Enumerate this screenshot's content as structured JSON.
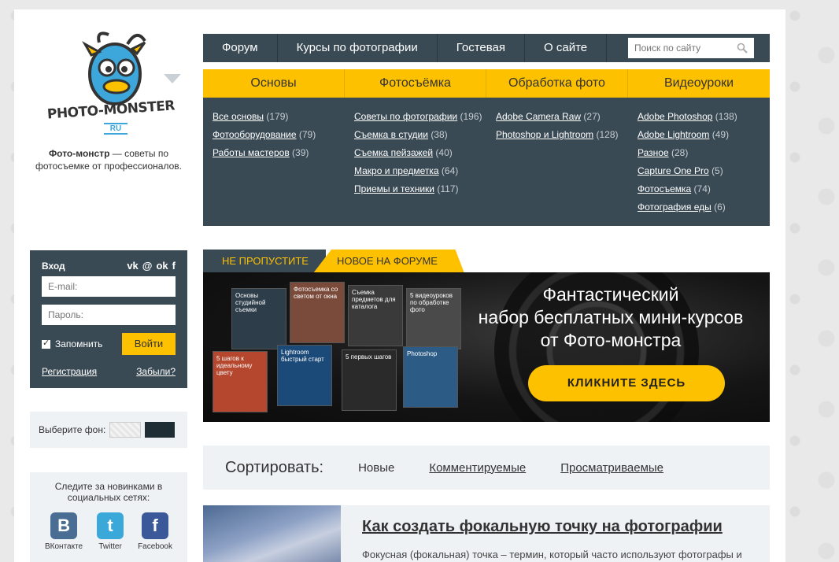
{
  "logo": {
    "brand": "PHOTO-MONSTER",
    "tld": "RU"
  },
  "tagline": {
    "bold": "Фото-монстр",
    "rest": " — советы по фотосъемке от профессионалов."
  },
  "topnav": {
    "items": [
      "Форум",
      "Курсы по фотографии",
      "Гостевая",
      "О сайте"
    ],
    "search_placeholder": "Поиск по сайту"
  },
  "categories": [
    "Основы",
    "Фотосъёмка",
    "Обработка фото",
    "Видеоуроки"
  ],
  "submenu": {
    "col1": [
      {
        "t": "Все основы",
        "c": "(179)"
      },
      {
        "t": "Фотооборудование",
        "c": "(79)"
      },
      {
        "t": "Работы мастеров",
        "c": "(39)"
      }
    ],
    "col2": [
      {
        "t": "Советы по фотографии",
        "c": "(196)"
      },
      {
        "t": "Съемка в студии",
        "c": "(38)"
      },
      {
        "t": "Съемка пейзажей",
        "c": "(40)"
      },
      {
        "t": "Макро и предметка",
        "c": "(64)"
      },
      {
        "t": "Приемы и техники",
        "c": "(117)"
      }
    ],
    "col3": [
      {
        "t": "Adobe Camera Raw",
        "c": "(27)"
      },
      {
        "t": "Photoshop и Lightroom",
        "c": "(128)"
      }
    ],
    "col4": [
      {
        "t": "Adobe Photoshop",
        "c": "(138)"
      },
      {
        "t": "Adobe Lightroom",
        "c": "(49)"
      },
      {
        "t": "Разное",
        "c": "(28)"
      },
      {
        "t": "Capture One Pro",
        "c": "(5)"
      },
      {
        "t": "Фотосъемка",
        "c": "(74)"
      },
      {
        "t": "Фотография еды",
        "c": "(6)"
      }
    ]
  },
  "login": {
    "title": "Вход",
    "email_placeholder": "E-mail:",
    "password_placeholder": "Пароль:",
    "remember": "Запомнить",
    "submit": "Войти",
    "register": "Регистрация",
    "forgot": "Забыли?"
  },
  "bg_chooser": {
    "label": "Выберите фон:"
  },
  "follow": {
    "text": "Следите за новинками в социальных сетях:",
    "networks": [
      {
        "label": "ВКонтакте",
        "glyph": "B",
        "color": "#4a6d94"
      },
      {
        "label": "Twitter",
        "glyph": "t",
        "color": "#3aa8d8"
      },
      {
        "label": "Facebook",
        "glyph": "f",
        "color": "#3b5998"
      }
    ]
  },
  "banner": {
    "tab1": "НЕ ПРОПУСТИТЕ",
    "tab2": "НОВОЕ НА ФОРУМЕ",
    "line1": "Фантастический",
    "line2": "набор бесплатных мини-курсов",
    "line3": "от Фото-монстра",
    "cta": "КЛИКНИТЕ ЗДЕСЬ",
    "boxes": [
      "Основы студийной съемки",
      "Фотосъемка со светом от окна",
      "Съемка предметов для каталога",
      "5 видеоуроков по обработке фото",
      "5 шагов к идеальному цвету",
      "Lightroom быстрый старт",
      "5 первых шагов",
      "Photoshop"
    ]
  },
  "sort": {
    "label": "Сортировать:",
    "options": [
      "Новые",
      "Комментируемые",
      "Просматриваемые"
    ]
  },
  "article": {
    "title": "Как создать фокальную точку на фотографии",
    "excerpt": "Фокусная (фокальная) точка – термин, который часто используют фотографы и блоги о фотосъемке. Они говорят: «Создайте фокальную"
  }
}
